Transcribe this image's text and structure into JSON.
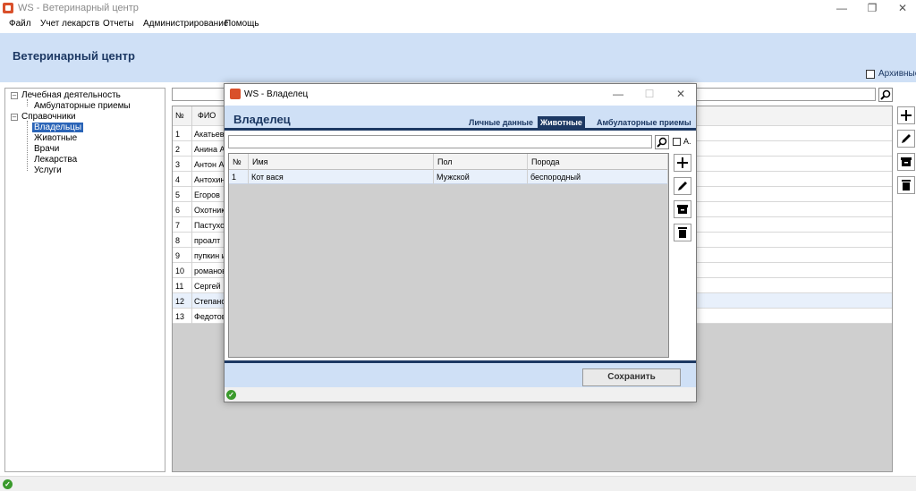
{
  "window": {
    "title": "WS - Ветеринарный центр"
  },
  "menu": [
    "Файл",
    "Учет лекарств",
    "Отчеты",
    "Администрирование",
    "Помощь"
  ],
  "header": {
    "title": "Ветеринарный центр",
    "archive_label": "Архивные"
  },
  "tree": {
    "root1": "Лечебная деятельность",
    "root1_child": "Амбулаторные приемы",
    "root2": "Справочники",
    "children": [
      "Владельцы",
      "Животные",
      "Врачи",
      "Лекарства",
      "Услуги"
    ]
  },
  "main_grid": {
    "headers": [
      "№",
      "ФИО"
    ],
    "rows": [
      [
        "1",
        "Акатьев"
      ],
      [
        "2",
        "Анина  А"
      ],
      [
        "3",
        "Антон Ан"
      ],
      [
        "4",
        "Антохин"
      ],
      [
        "5",
        "Егоров"
      ],
      [
        "6",
        "Охотник"
      ],
      [
        "7",
        "Пастухов"
      ],
      [
        "8",
        "проалт"
      ],
      [
        "9",
        "пупкин и"
      ],
      [
        "10",
        "романов"
      ],
      [
        "11",
        "Сергей"
      ],
      [
        "12",
        "Степано"
      ],
      [
        "13",
        "Федотов"
      ]
    ]
  },
  "dialog": {
    "title": "WS - Владелец",
    "heading": "Владелец",
    "tabs": [
      "Личные данные",
      "Животные",
      "Амбулаторные приемы"
    ],
    "archive_label": "А.",
    "grid": {
      "headers": [
        "№",
        "Имя",
        "Пол",
        "Порода"
      ],
      "rows": [
        [
          "1",
          "Кот вася",
          "Мужской",
          "беспородный"
        ]
      ]
    },
    "save_label": "Сохранить"
  },
  "colors": {
    "header_bg": "#cfe0f6",
    "accent": "#1c3863",
    "selection": "#2a64b7",
    "ok": "#3a9a2c"
  }
}
